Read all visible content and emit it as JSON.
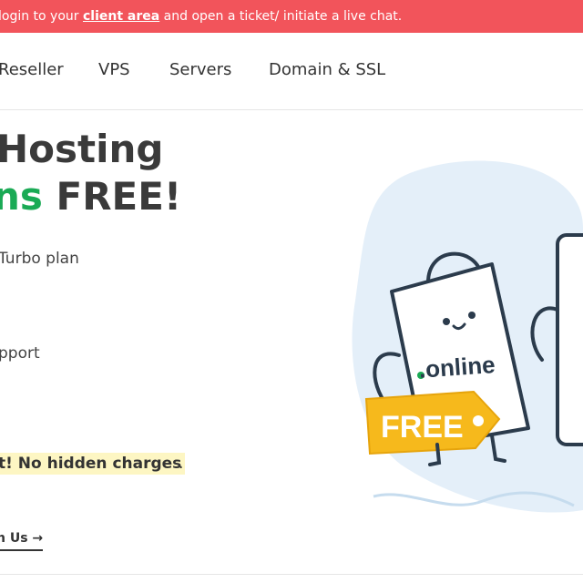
{
  "announcement": {
    "prefix": "login to your ",
    "link": "client area",
    "suffix": " and open a ticket/ initiate a live chat."
  },
  "nav": {
    "items": [
      "Reseller",
      "VPS",
      "Servers",
      "Domain & SSL"
    ]
  },
  "hero": {
    "title_line1": "Hosting",
    "title_line2_accent": "ns",
    "title_line2_rest": " FREE!",
    "feature1": "Turbo plan",
    "feature2": "pport",
    "highlight": "t! No hidden charges",
    "highlight_period": ".",
    "cta": "h Us",
    "cta_arrow": "→"
  },
  "illustration": {
    "domain_label": ".online",
    "tag_label": "FREE",
    "accent_color": "#f6b91c",
    "dot_color": "#1aaa55"
  }
}
